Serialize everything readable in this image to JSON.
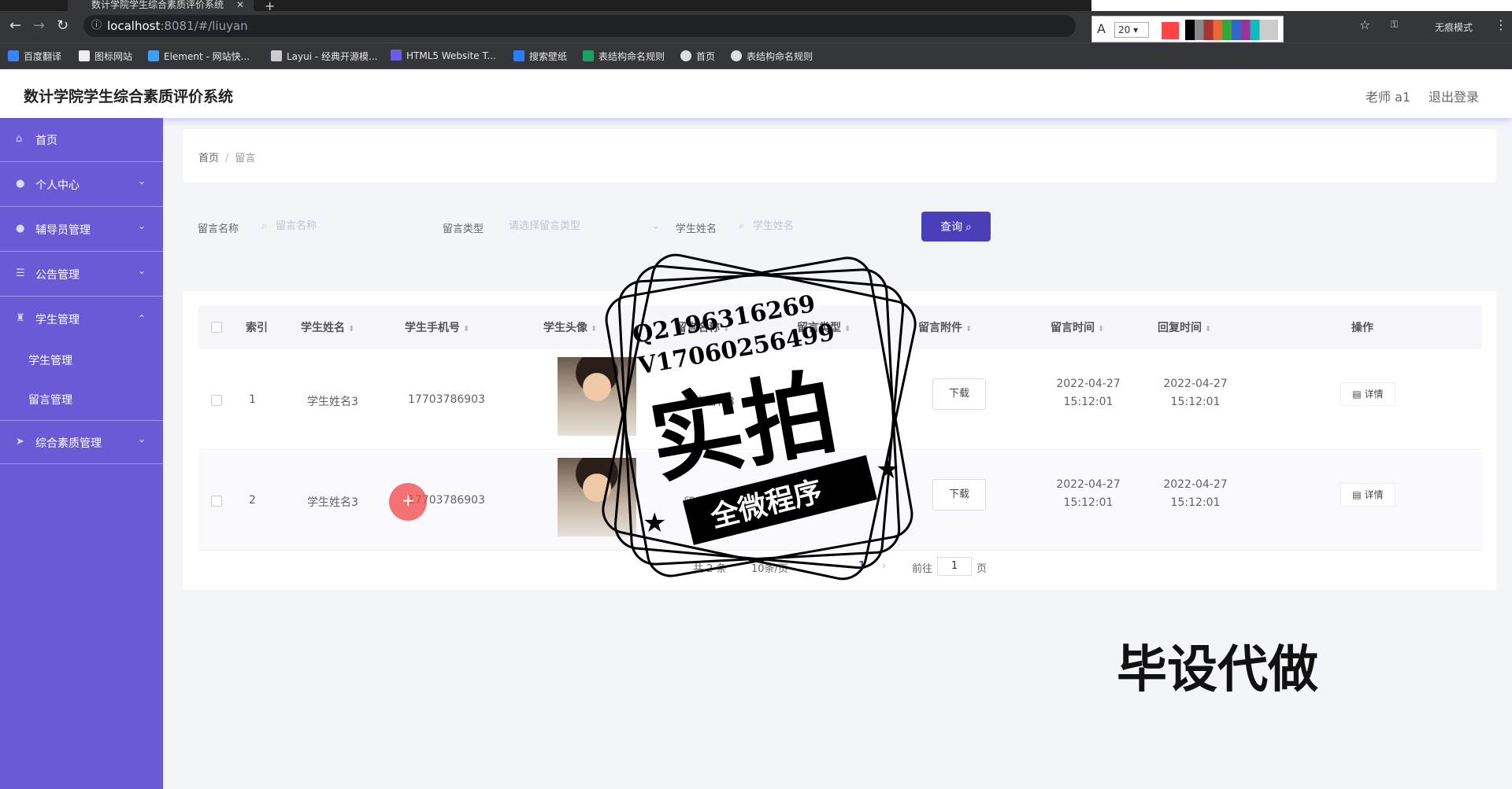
{
  "browser": {
    "tab_title": "数计学院学生综合素质评价系统",
    "url_host": "localhost",
    "url_rest": ":8081/#/liuyan",
    "font_size": "20",
    "incognito_label": "无痕模式",
    "bookmarks": [
      "百度翻译",
      "图标网站",
      "Element - 网站快...",
      "Layui - 经典开源模...",
      "HTML5 Website T...",
      "搜索壁纸",
      "表结构命名规则",
      "首页",
      "表结构命名规则"
    ]
  },
  "header": {
    "title": "数计学院学生综合素质评价系统",
    "user": "老师 a1",
    "logout": "退出登录"
  },
  "sidebar": {
    "items": [
      {
        "label": "首页",
        "icon": "home-icon"
      },
      {
        "label": "个人中心",
        "icon": "user-icon"
      },
      {
        "label": "辅导员管理",
        "icon": "user-icon"
      },
      {
        "label": "公告管理",
        "icon": "list-icon"
      },
      {
        "label": "学生管理",
        "icon": "trophy-icon"
      },
      {
        "label": "综合素质管理",
        "icon": "send-icon"
      }
    ],
    "sub_items": [
      "学生管理",
      "留言管理"
    ]
  },
  "breadcrumb": {
    "home": "首页",
    "current": "留言"
  },
  "filters": {
    "name_label": "留言名称",
    "name_placeholder": "留言名称",
    "type_label": "留言类型",
    "type_placeholder": "请选择留言类型",
    "student_label": "学生姓名",
    "student_placeholder": "学生姓名",
    "query_label": "查询"
  },
  "table": {
    "headers": [
      "索引",
      "学生姓名",
      "学生手机号",
      "学生头像",
      "留言名称",
      "留言类型",
      "留言附件",
      "留言时间",
      "回复时间",
      "操作"
    ],
    "rows": [
      {
        "index": "1",
        "name": "学生姓名3",
        "phone": "17703786903",
        "msg_name": "留言名称3",
        "download": "下载",
        "msg_time": "2022-04-27 15:12:01",
        "reply_time": "2022-04-27 15:12:01",
        "action": "详情"
      },
      {
        "index": "2",
        "name": "学生姓名3",
        "phone": "17703786903",
        "msg_name": "留言名称",
        "download": "下载",
        "msg_time": "2022-04-27 15:12:01",
        "reply_time": "2022-04-27 15:12:01",
        "action": "详情"
      }
    ]
  },
  "pager": {
    "total": "共 2 条",
    "page_size": "10条/页",
    "current": "1",
    "goto_label": "前往",
    "goto_value": "1",
    "page_unit": "页"
  },
  "overlay": {
    "qq": "Q2196316269",
    "vx": "V17060256499",
    "stamp_main": "实拍",
    "stamp_banner": "全微程序",
    "watermark": "毕设代做"
  },
  "colors": {
    "sidebar": "#6a5ad6",
    "accent": "#4a3fb8",
    "page_bg": "#f4f5f9"
  }
}
